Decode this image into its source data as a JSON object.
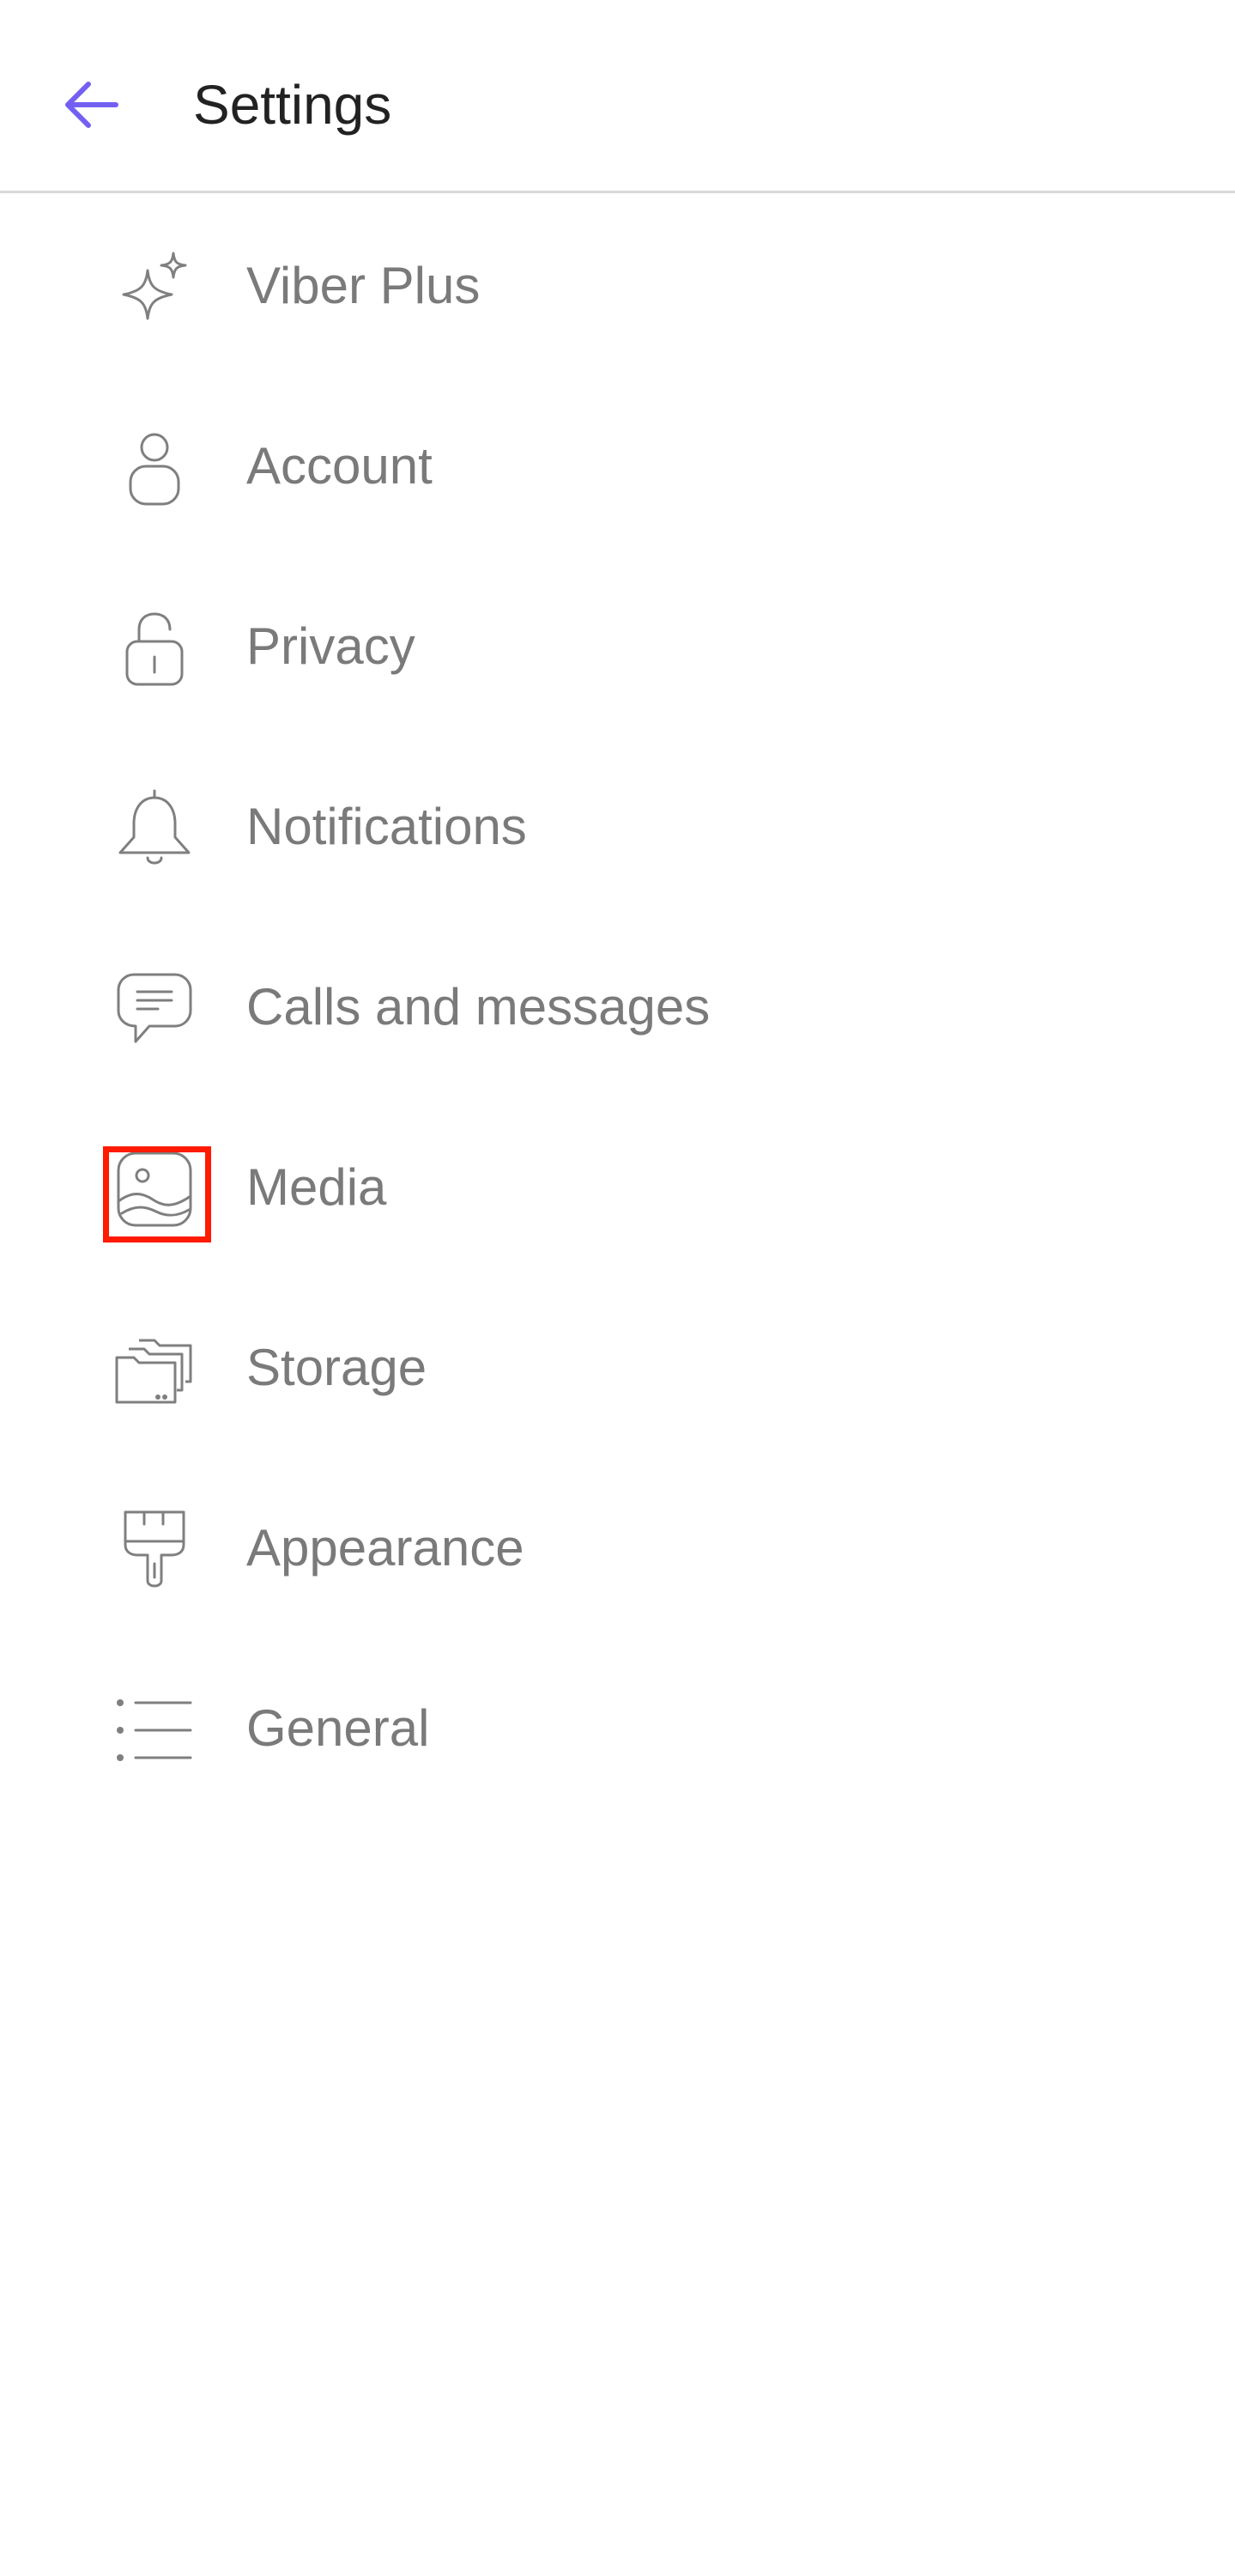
{
  "header": {
    "title": "Settings",
    "back_icon": "arrow-left-icon",
    "accent_color": "#7360f2"
  },
  "settings": {
    "items": [
      {
        "label": "Viber Plus",
        "icon": "sparkle-icon"
      },
      {
        "label": "Account",
        "icon": "person-icon"
      },
      {
        "label": "Privacy",
        "icon": "lock-icon"
      },
      {
        "label": "Notifications",
        "icon": "bell-icon"
      },
      {
        "label": "Calls and messages",
        "icon": "chat-bubble-icon"
      },
      {
        "label": "Media",
        "icon": "image-icon"
      },
      {
        "label": "Storage",
        "icon": "folders-icon"
      },
      {
        "label": "Appearance",
        "icon": "paintbrush-icon"
      },
      {
        "label": "General",
        "icon": "list-icon"
      }
    ],
    "highlighted_item": "Media",
    "highlight_color": "#ff1a00",
    "text_color": "#7a7a7a",
    "icon_color": "#7f7f7f"
  }
}
